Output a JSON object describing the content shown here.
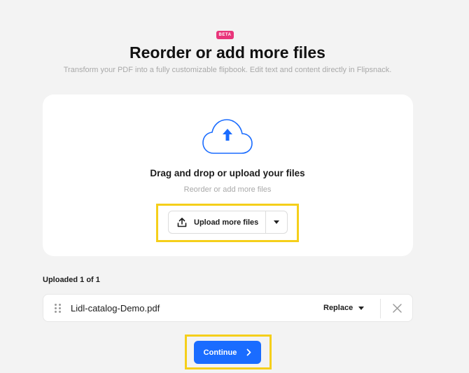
{
  "header": {
    "badge": "BETA",
    "title": "Reorder or add more files",
    "subtitle": "Transform your PDF into a fully customizable flipbook. Edit text and content directly in Flipsnack."
  },
  "dropzone": {
    "icon": "cloud-upload-icon",
    "title": "Drag and drop or upload your files",
    "subtitle": "Reorder or add more files",
    "upload_button": "Upload more files"
  },
  "uploads": {
    "label": "Uploaded 1 of 1",
    "files": [
      {
        "name": "Lidl-catalog-Demo.pdf",
        "action": "Replace"
      }
    ]
  },
  "footer": {
    "continue_label": "Continue"
  },
  "colors": {
    "accent": "#1a6cff",
    "badge": "#e8347a",
    "highlight": "#f5cf1a",
    "background": "#f3f3f3"
  }
}
